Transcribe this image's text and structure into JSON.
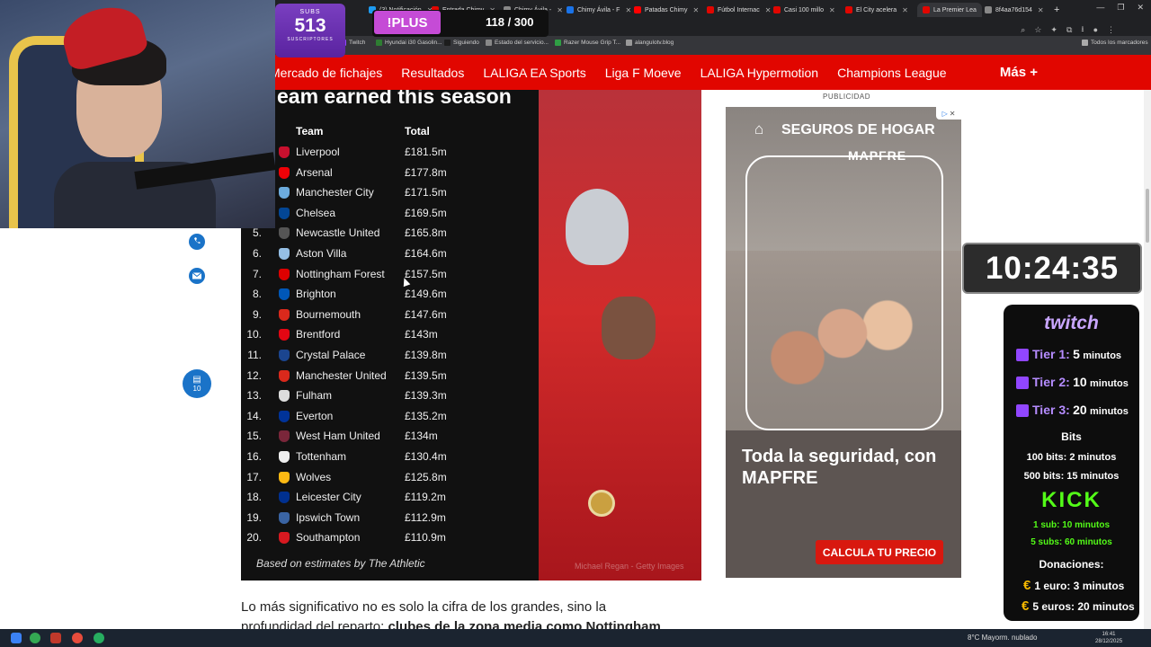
{
  "browser": {
    "tabs": [
      {
        "label": "(3) Notificación",
        "color": "#1d9bf0"
      },
      {
        "label": "Entrada Chimy",
        "color": "#e10600"
      },
      {
        "label": "Chimy Ávila - ",
        "color": "#888888"
      },
      {
        "label": "Chimy Ávila - F",
        "color": "#1a73e8"
      },
      {
        "label": "Patadas Chimy",
        "color": "#ff0000"
      },
      {
        "label": "Fútbol Internac",
        "color": "#e10600"
      },
      {
        "label": "Casi 100 millo",
        "color": "#e10600"
      },
      {
        "label": "El City acelera",
        "color": "#e10600"
      },
      {
        "label": "La Premier Lea",
        "color": "#e10600",
        "active": true
      },
      {
        "label": "8f4aa76d154",
        "color": "#888888"
      }
    ],
    "bookmarks": [
      "Twitch",
      "Hyundai i30 Gasolin...",
      "Siguiendo",
      "Estado del servicio...",
      "Razer Mouse Grip T...",
      "alangulotv.blog",
      "Todos los marcadores"
    ]
  },
  "nav": {
    "items": [
      "Mercado de fichajes",
      "Resultados",
      "LALIGA EA Sports",
      "Liga F Moeve",
      "LALIGA Hypermotion",
      "Champions League"
    ],
    "more": "Más +"
  },
  "overlay": {
    "subs_label": "SUBS",
    "subs_count": "513",
    "subs_sub": "SUSCRIPTORES",
    "plus_label": "!PLUS",
    "plus_progress": "118 / 300",
    "timer": "10:24:35"
  },
  "article": {
    "image_title": "eam earned this season",
    "header_team": "Team",
    "header_total": "Total",
    "source": "Based on estimates by The Athletic",
    "photo_credit": "Michael Regan - Getty Images",
    "body_line1": "Lo más significativo no es solo la cifra de los grandes, sino la",
    "body_line2": "profundidad del reparto: ",
    "body_bold": "clubes de la zona media como Nottingham",
    "comments_count": "10"
  },
  "table": {
    "rows": [
      {
        "rank": "",
        "team": "Liverpool",
        "total": "£181.5m",
        "crest": "#c8102e"
      },
      {
        "rank": "",
        "team": "Arsenal",
        "total": "£177.8m",
        "crest": "#ef0107"
      },
      {
        "rank": "",
        "team": "Manchester City",
        "total": "£171.5m",
        "crest": "#6cabdd"
      },
      {
        "rank": "",
        "team": "Chelsea",
        "total": "£169.5m",
        "crest": "#034694"
      },
      {
        "rank": "5.",
        "team": "Newcastle United",
        "total": "£165.8m",
        "crest": "#555555"
      },
      {
        "rank": "6.",
        "team": "Aston Villa",
        "total": "£164.6m",
        "crest": "#95bfe5"
      },
      {
        "rank": "7.",
        "team": "Nottingham Forest",
        "total": "£157.5m",
        "crest": "#dd0000"
      },
      {
        "rank": "8.",
        "team": "Brighton",
        "total": "£149.6m",
        "crest": "#0057b8"
      },
      {
        "rank": "9.",
        "team": "Bournemouth",
        "total": "£147.6m",
        "crest": "#da291c"
      },
      {
        "rank": "10.",
        "team": "Brentford",
        "total": "£143m",
        "crest": "#e30613"
      },
      {
        "rank": "11.",
        "team": "Crystal Palace",
        "total": "£139.8m",
        "crest": "#1b458f"
      },
      {
        "rank": "12.",
        "team": "Manchester United",
        "total": "£139.5m",
        "crest": "#da291c"
      },
      {
        "rank": "13.",
        "team": "Fulham",
        "total": "£139.3m",
        "crest": "#dddddd"
      },
      {
        "rank": "14.",
        "team": "Everton",
        "total": "£135.2m",
        "crest": "#003399"
      },
      {
        "rank": "15.",
        "team": "West Ham United",
        "total": "£134m",
        "crest": "#7a263a"
      },
      {
        "rank": "16.",
        "team": "Tottenham",
        "total": "£130.4m",
        "crest": "#eeeeee"
      },
      {
        "rank": "17.",
        "team": "Wolves",
        "total": "£125.8m",
        "crest": "#fdb913"
      },
      {
        "rank": "18.",
        "team": "Leicester City",
        "total": "£119.2m",
        "crest": "#003090"
      },
      {
        "rank": "19.",
        "team": "Ipswich Town",
        "total": "£112.9m",
        "crest": "#3a64a3"
      },
      {
        "rank": "20.",
        "team": "Southampton",
        "total": "£110.9m",
        "crest": "#d71920"
      }
    ]
  },
  "ad": {
    "label": "PUBLICIDAD",
    "title": "SEGUROS DE HOGAR",
    "brand": "MAPFRE",
    "headline": "Toda la seguridad, con MAPFRE",
    "cta": "CALCULA TU PRECIO"
  },
  "panel": {
    "twitch": "twitch",
    "tiers": [
      {
        "label": "Tier 1:",
        "value": "5",
        "unit": "minutos"
      },
      {
        "label": "Tier 2:",
        "value": "10",
        "unit": "minutos"
      },
      {
        "label": "Tier 3:",
        "value": "20",
        "unit": "minutos"
      }
    ],
    "bits_title": "Bits",
    "bits_1": "100 bits: 2 minutos",
    "bits_2": "500 bits: 15 minutos",
    "kick": "KICK",
    "kick_1": "1 sub: 10 minutos",
    "kick_2": "5 subs: 60 minutos",
    "donations_title": "Donaciones:",
    "don_1": "1 euro: 3 minutos",
    "don_2": "5 euros: 20 minutos"
  },
  "taskbar": {
    "weather": "8°C  Mayorm. nublado",
    "time": "16:41",
    "date": "28/12/2025"
  }
}
